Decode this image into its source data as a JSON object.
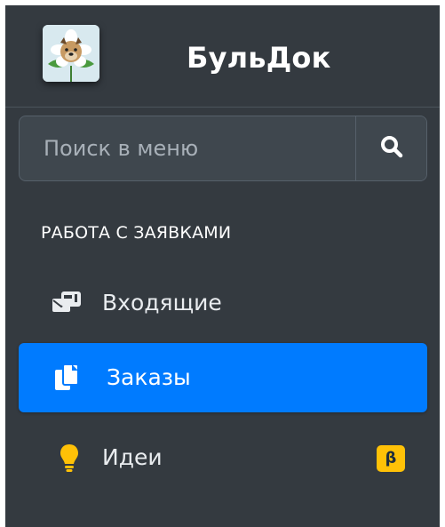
{
  "brand": {
    "name": "БульДок",
    "logo_icon": "bulldog-flower-logo"
  },
  "search": {
    "placeholder": "Поиск в меню",
    "button_icon": "search-icon"
  },
  "section": {
    "title": "РАБОТА С ЗАЯВКАМИ"
  },
  "nav": {
    "items": [
      {
        "label": "Входящие",
        "icon": "mailbox-icon",
        "active": false
      },
      {
        "label": "Заказы",
        "icon": "copy-icon",
        "active": true
      },
      {
        "label": "Идеи",
        "icon": "lightbulb-icon",
        "active": false,
        "badge": "β",
        "badge_color": "#ffc107"
      }
    ]
  },
  "colors": {
    "sidebar_bg": "#343a40",
    "active_bg": "#007bff",
    "badge": "#ffc107",
    "lightbulb": "#ffc107"
  }
}
